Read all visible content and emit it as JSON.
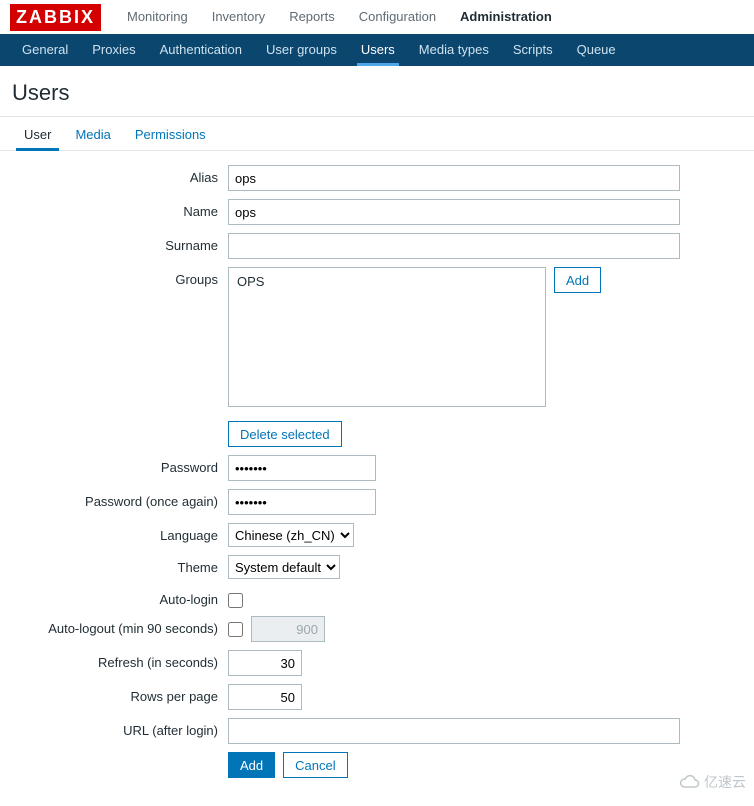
{
  "brand": "ZABBIX",
  "topnav": {
    "items": [
      {
        "label": "Monitoring"
      },
      {
        "label": "Inventory"
      },
      {
        "label": "Reports"
      },
      {
        "label": "Configuration"
      },
      {
        "label": "Administration",
        "active": true
      }
    ]
  },
  "subnav": {
    "items": [
      {
        "label": "General"
      },
      {
        "label": "Proxies"
      },
      {
        "label": "Authentication"
      },
      {
        "label": "User groups"
      },
      {
        "label": "Users",
        "active": true
      },
      {
        "label": "Media types"
      },
      {
        "label": "Scripts"
      },
      {
        "label": "Queue"
      }
    ]
  },
  "page_title": "Users",
  "tabs": {
    "items": [
      {
        "label": "User",
        "active": true
      },
      {
        "label": "Media"
      },
      {
        "label": "Permissions"
      }
    ]
  },
  "form": {
    "alias": {
      "label": "Alias",
      "value": "ops"
    },
    "name": {
      "label": "Name",
      "value": "ops"
    },
    "surname": {
      "label": "Surname",
      "value": ""
    },
    "groups": {
      "label": "Groups",
      "selected": "OPS",
      "add_btn": "Add",
      "delete_btn": "Delete selected"
    },
    "password": {
      "label": "Password",
      "value": "•••••••"
    },
    "password2": {
      "label": "Password (once again)",
      "value": "•••••••"
    },
    "language": {
      "label": "Language",
      "options": [
        "Chinese (zh_CN)"
      ],
      "selected": "Chinese (zh_CN)"
    },
    "theme": {
      "label": "Theme",
      "options": [
        "System default"
      ],
      "selected": "System default"
    },
    "autologin": {
      "label": "Auto-login",
      "checked": false
    },
    "autologout": {
      "label": "Auto-logout (min 90 seconds)",
      "checked": false,
      "value": "900"
    },
    "refresh": {
      "label": "Refresh (in seconds)",
      "value": "30"
    },
    "rows": {
      "label": "Rows per page",
      "value": "50"
    },
    "url": {
      "label": "URL (after login)",
      "value": ""
    },
    "submit": {
      "add": "Add",
      "cancel": "Cancel"
    }
  },
  "watermark": "亿速云"
}
